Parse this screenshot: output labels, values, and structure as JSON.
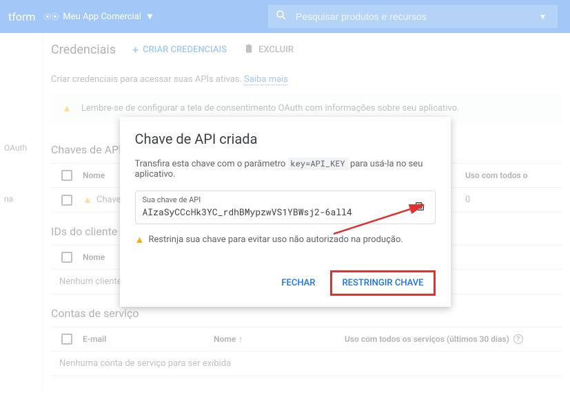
{
  "topbar": {
    "platform_suffix": "tform",
    "project_name": "Meu App Comercial",
    "search_placeholder": "Pesquisar produtos e recursos"
  },
  "sidebar": {
    "items": [
      "",
      "OAuth",
      "",
      "na"
    ]
  },
  "header": {
    "title": "Credenciais",
    "create_label": "CRIAR CREDENCIAIS",
    "delete_label": "EXCLUIR"
  },
  "intro": {
    "text": "Criar credenciais para acessar suas APIs ativas.",
    "link": "Saiba mais"
  },
  "banner": {
    "text": "Lembre-se de configurar a tela de consentimento OAuth com informações sobre seu aplicativo."
  },
  "api_keys": {
    "section_title": "Chaves de API",
    "col_name": "Nome",
    "col_usage": "Uso com todos o",
    "rows": [
      {
        "name": "Chave de API",
        "usage": "0"
      }
    ]
  },
  "oauth_clients": {
    "section_title": "IDs do cliente OA",
    "col_name": "Nome",
    "empty": "Nenhum cliente do OAuth"
  },
  "service_accounts": {
    "section_title": "Contas de serviço",
    "col_email": "E-mail",
    "col_name": "Nome",
    "col_usage": "Uso com todos os serviços (últimos 30 dias)",
    "empty": "Nenhuma conta de serviço para ser exibida"
  },
  "modal": {
    "title": "Chave de API criada",
    "desc_before": "Transfira esta chave com o parâmetro ",
    "desc_code": "key=API_KEY",
    "desc_after": " para usá-la no seu aplicativo.",
    "key_label": "Sua chave de API",
    "key_value": "AIzaSyCCcHk3YC_rdhBMypzwVS1YBWsj2-6all4",
    "restrict_warn": "Restrinja sua chave para evitar uso não autorizado na produção.",
    "close_label": "FECHAR",
    "restrict_label": "RESTRINGIR CHAVE"
  }
}
